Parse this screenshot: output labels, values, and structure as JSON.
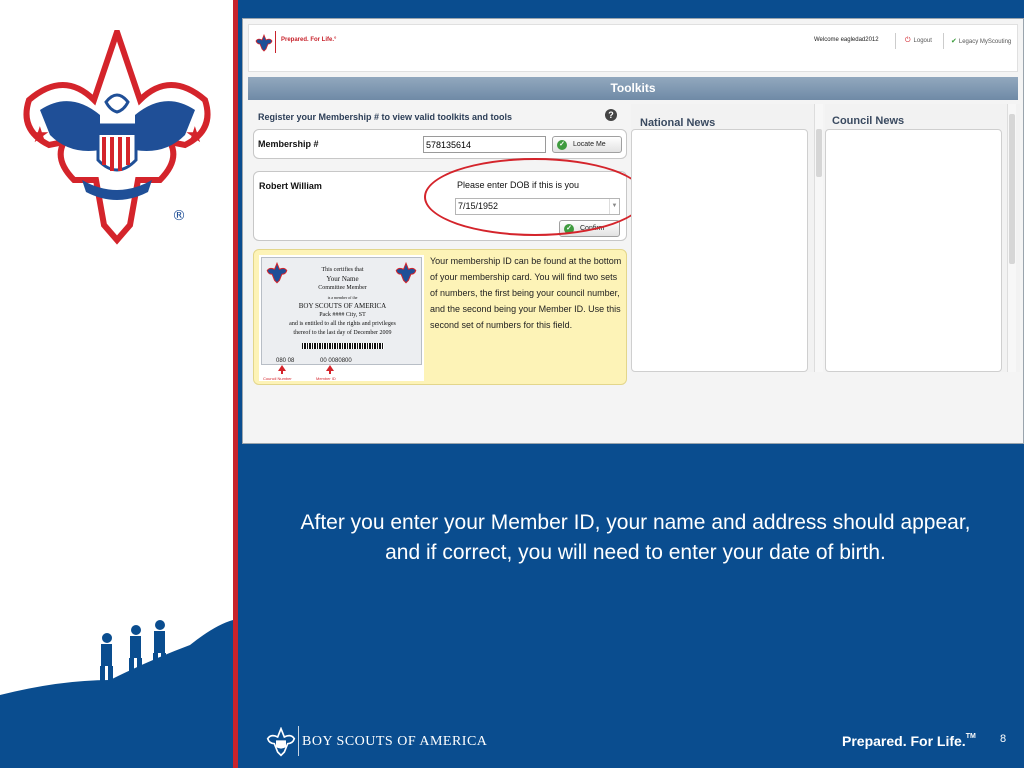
{
  "app": {
    "header": {
      "brand": "Prepared. For Life.°",
      "welcome": "Welcome eagledad2012",
      "logout": "Logout",
      "legacy": "Legacy MyScouting"
    },
    "toolkits_title": "Toolkits",
    "register": {
      "title": "Register your Membership # to view valid toolkits and tools",
      "help": "?",
      "membership_label": "Membership #",
      "membership_value": "578135614",
      "locate_label": "Locate Me"
    },
    "person": {
      "name": "Robert William",
      "dob_prompt": "Please enter DOB if this is you",
      "dob_value": "7/15/1952",
      "confirm_label": "Confirm"
    },
    "help_box": {
      "text": "Your membership ID can be found at the bottom of your membership card. You will find two sets of numbers, the first being your council number, and the second being your Member ID. Use this second set of numbers for this field.",
      "card": {
        "line1": "This certifies that",
        "line2": "Your Name",
        "line3": "Committee Member",
        "line4": "is a member of the",
        "line5": "BOY SCOUTS OF AMERICA",
        "line6": "Pack #### City, ST",
        "line7": "and is entitled to all the rights and privileges",
        "line8": "thereof to the last day of December 2009",
        "council_number": "080 08",
        "member_id": "00 0080800",
        "council_label": "Council Number",
        "member_label": "Member ID"
      }
    },
    "national_news_title": "National News",
    "council_news_title": "Council News"
  },
  "caption": "After you enter your Member ID, your name and address should appear, and if correct, you will need to enter your date of birth.",
  "footer": {
    "org": "BOY SCOUTS OF AMERICA",
    "prepared": "Prepared. For Life.",
    "tm": "TM",
    "page": "8"
  },
  "colors": {
    "slide_blue": "#0a4d8f",
    "bsa_red": "#c8232c",
    "help_yellow": "#fdf3b7"
  }
}
